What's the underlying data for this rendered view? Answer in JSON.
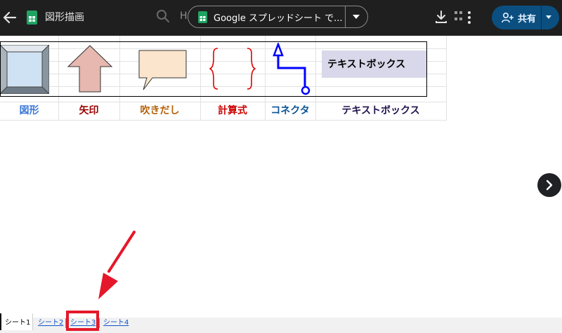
{
  "topbar": {
    "title": "図形描画",
    "search_hint": "H",
    "open_with_label": "Google スプレッドシート で...",
    "share_label": "共有"
  },
  "sheet": {
    "textbox_text": "テキストボックス",
    "labels": [
      {
        "text": "図形",
        "color": "#3c78d8"
      },
      {
        "text": "矢印",
        "color": "#990000"
      },
      {
        "text": "吹きだし",
        "color": "#b45f06"
      },
      {
        "text": "計算式",
        "color": "#cc0000"
      },
      {
        "text": "コネクタ",
        "color": "#0b5394"
      },
      {
        "text": "テキストボックス",
        "color": "#20124d"
      }
    ]
  },
  "tabs": [
    {
      "label": "シート1",
      "active": true
    },
    {
      "label": "シート2",
      "active": false
    },
    {
      "label": "シート3",
      "active": false,
      "highlighted": true
    },
    {
      "label": "シート4",
      "active": false
    }
  ],
  "colors": {
    "topbar_bg": "#1f1f1f",
    "share_bg": "#0b4f80",
    "highlight": "#e4182a"
  }
}
